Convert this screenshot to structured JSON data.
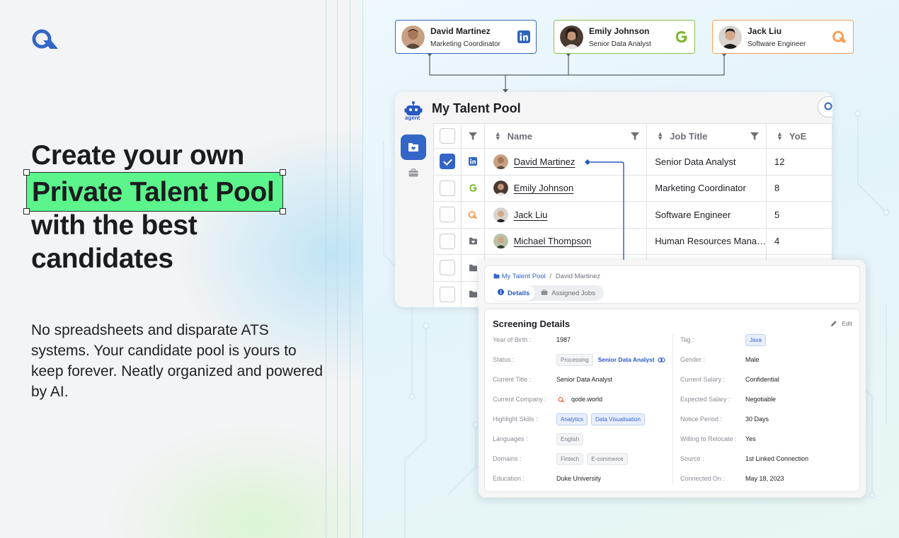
{
  "hero": {
    "headline_line1": "Create your own",
    "headline_highlight": "Private Talent Pool",
    "headline_line3": "with the best",
    "headline_line4": "candidates",
    "subtext": "No spreadsheets and disparate ATS systems. Your candidate pool is yours to keep forever. Neatly organized and powered by AI."
  },
  "profile_cards": [
    {
      "name": "David Martinez",
      "role": "Marketing Coordinator",
      "source_icon": "linkedin-icon",
      "border_color": "#3466c7"
    },
    {
      "name": "Emily Johnson",
      "role": "Senior Data Analyst",
      "source_icon": "g-icon",
      "border_color": "#8bc34a"
    },
    {
      "name": "Jack Liu",
      "role": "Software Engineer",
      "source_icon": "qode-icon",
      "border_color": "#f5a05a"
    }
  ],
  "talent_pool": {
    "agent_label": "agent",
    "title": "My Talent Pool",
    "columns": {
      "name": "Name",
      "job_title": "Job Title",
      "yoe": "YoE"
    },
    "rows": [
      {
        "name": "David Martinez",
        "job_title": "Senior Data Analyst",
        "yoe": "12",
        "checked": true,
        "source": "linkedin-icon"
      },
      {
        "name": "Emily Johnson",
        "job_title": "Marketing Coordinator",
        "yoe": "8",
        "checked": false,
        "source": "g-icon"
      },
      {
        "name": "Jack Liu",
        "job_title": "Software Engineer",
        "yoe": "5",
        "checked": false,
        "source": "qode-icon"
      },
      {
        "name": "Michael Thompson",
        "job_title": "Human Resources Mana…",
        "yoe": "4",
        "checked": false,
        "source": "folder-icon"
      }
    ]
  },
  "details": {
    "breadcrumb_root": "My Talent Pool",
    "breadcrumb_sep": "/",
    "breadcrumb_current": "David Martinez",
    "tab_details": "Details",
    "tab_jobs": "Assigned Jobs",
    "section_title": "Screening Details",
    "edit_label": "Edit",
    "left": {
      "yob_k": "Year of Birth :",
      "yob_v": "1987",
      "status_k": "Status :",
      "status_chip": "Processing",
      "status_link": "Senior Data Analyst",
      "title_k": "Current Title :",
      "title_v": "Senior Data Analyst",
      "company_k": "Current Company :",
      "company_v": "qode.world",
      "skills_k": "Highlight Skills :",
      "skill_1": "Analytics",
      "skill_2": "Data Visualisation",
      "lang_k": "Languages :",
      "lang_1": "English",
      "domains_k": "Domains :",
      "domain_1": "Fintech",
      "domain_2": "E-commerce",
      "edu_k": "Education :",
      "edu_v": "Duke University"
    },
    "right": {
      "tag_k": "Tag :",
      "tag_v": "Java",
      "gender_k": "Gender :",
      "gender_v": "Male",
      "salary_k": "Current Salary :",
      "salary_v": "Confidential",
      "exp_k": "Expected Salary :",
      "exp_v": "Negotiable",
      "notice_k": "Notice Period :",
      "notice_v": "30 Days",
      "relocate_k": "Willing to Relocate :",
      "relocate_v": "Yes",
      "source_k": "Source :",
      "source_v": "1st Linked Connection",
      "connected_k": "Connected On :",
      "connected_v": "May 18, 2023"
    }
  },
  "colors": {
    "accent": "#3466c7",
    "highlight": "#5cf58c"
  }
}
